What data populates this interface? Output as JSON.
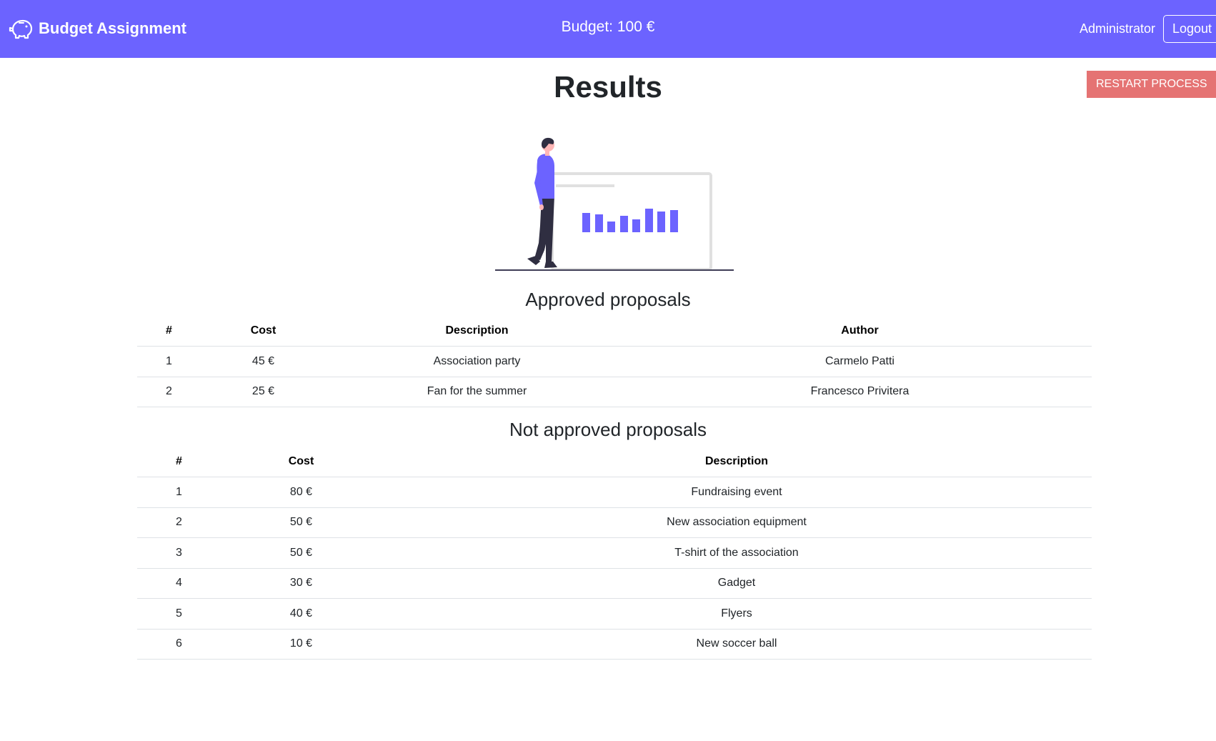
{
  "navbar": {
    "brand": "Budget Assignment",
    "brand_icon": "piggy-bank-icon",
    "budget": "Budget: 100 €",
    "user": "Administrator",
    "logout": "Logout",
    "color": "#6c63ff"
  },
  "page": {
    "title": "Results",
    "restart_label": "RESTART PROCESS",
    "restart_color": "#e57373",
    "illustration_icon": "data-presentation-illustration"
  },
  "approved": {
    "title": "Approved proposals",
    "columns": [
      "#",
      "Cost",
      "Description",
      "Author"
    ],
    "rows": [
      {
        "n": "1",
        "cost": "45 €",
        "description": "Association party",
        "author": "Carmelo Patti"
      },
      {
        "n": "2",
        "cost": "25 €",
        "description": "Fan for the summer",
        "author": "Francesco Privitera"
      }
    ]
  },
  "not_approved": {
    "title": "Not approved proposals",
    "columns": [
      "#",
      "Cost",
      "Description"
    ],
    "rows": [
      {
        "n": "1",
        "cost": "80 €",
        "description": "Fundraising event"
      },
      {
        "n": "2",
        "cost": "50 €",
        "description": "New association equipment"
      },
      {
        "n": "3",
        "cost": "50 €",
        "description": "T-shirt of the association"
      },
      {
        "n": "4",
        "cost": "30 €",
        "description": "Gadget"
      },
      {
        "n": "5",
        "cost": "40 €",
        "description": "Flyers"
      },
      {
        "n": "6",
        "cost": "10 €",
        "description": "New soccer ball"
      }
    ]
  }
}
